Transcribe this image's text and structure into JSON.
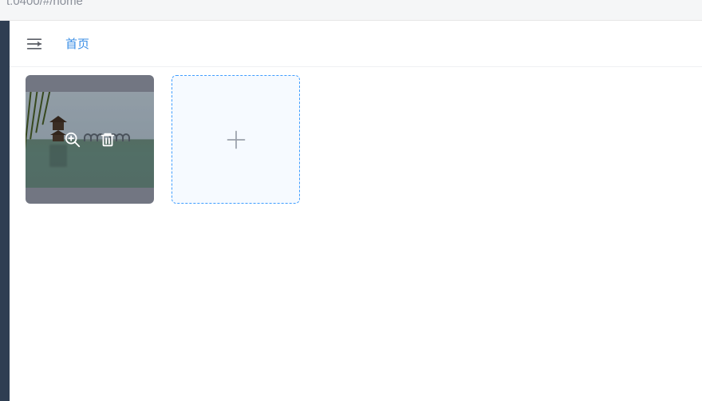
{
  "browser": {
    "url_fragment": "t:0400/#/home"
  },
  "header": {
    "menu_toggle_icon": "fold-menu-icon",
    "breadcrumb": "首页"
  },
  "uploader": {
    "overlay_actions": {
      "preview": "zoom-in-icon",
      "delete": "trash-icon"
    },
    "add_slot_icon": "plus-icon"
  },
  "colors": {
    "accent": "#409eff",
    "sidebar": "#2f3e52"
  }
}
